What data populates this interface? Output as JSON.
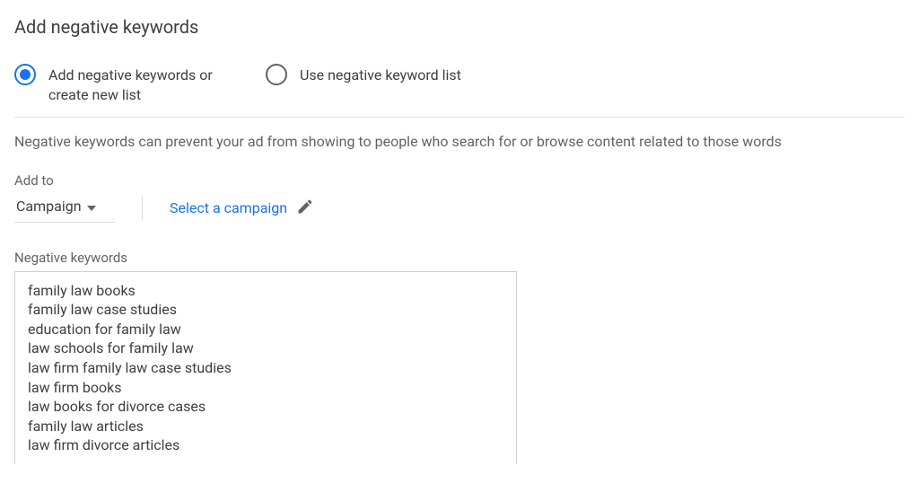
{
  "page_title": "Add negative keywords",
  "radio": {
    "option1_label": "Add negative keywords or create new list",
    "option2_label": "Use negative keyword list"
  },
  "description_text": "Negative keywords can prevent your ad from showing to people who search for or browse content related to those words",
  "add_to": {
    "label": "Add to",
    "dropdown_value": "Campaign",
    "select_campaign_label": "Select a campaign"
  },
  "negative_keywords": {
    "label": "Negative keywords",
    "items": [
      "family law books",
      "family law case studies",
      "education for family law",
      "law schools for family law",
      "law firm family law case studies",
      "law firm books",
      "law books for divorce cases",
      "family law articles",
      "law firm divorce articles"
    ]
  }
}
